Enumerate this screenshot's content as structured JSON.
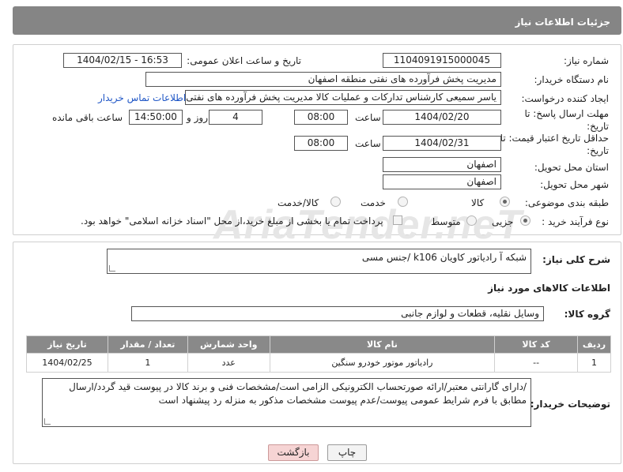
{
  "header": {
    "title": "جزئیات اطلاعات نیاز"
  },
  "fields": {
    "need_number_label": "شماره نیاز:",
    "need_number": "1104091915000045",
    "announce_label": "تاریخ و ساعت اعلان عمومی:",
    "announce_value": "1404/02/15 - 16:53",
    "buyer_org_label": "نام دستگاه خریدار:",
    "buyer_org": "مدیریت پخش فرآورده های نفتی منطقه اصفهان",
    "requester_label": "ایجاد کننده درخواست:",
    "requester": "یاسر  سمیعی کارشناس تدارکات و عملیات کالا مدیریت پخش فرآورده های نفتی",
    "contact_link": "اطلاعات تماس خریدار",
    "deadline_label": "مهلت ارسال پاسخ: تا تاریخ:",
    "deadline_date": "1404/02/20",
    "time_label": "ساعت",
    "deadline_time": "08:00",
    "days_value": "4",
    "days_label": "روز و",
    "remaining_time": "14:50:00",
    "remaining_label": "ساعت باقی مانده",
    "validity_label": "حداقل تاریخ اعتبار قیمت: تا تاریخ:",
    "validity_date": "1404/02/31",
    "validity_time": "08:00",
    "province_label": "استان محل تحویل:",
    "province": "اصفهان",
    "city_label": "شهر محل تحویل:",
    "city": "اصفهان",
    "category_label": "طبقه بندی موضوعی:",
    "category_options": [
      "کالا",
      "خدمت",
      "کالا/خدمت"
    ],
    "process_label": "نوع فرآیند خرید :",
    "process_options": [
      "جزیی",
      "متوسط"
    ],
    "payment_note": "پرداخت تمام یا بخشی از مبلغ خرید،از محل \"اسناد خزانه اسلامی\" خواهد بود."
  },
  "description": {
    "label": "شرح کلی نیاز:",
    "value": "شبکه آ رادیاتور کاویان k106 /جنس مسی"
  },
  "goods_section_title": "اطلاعات کالاهای مورد نیاز",
  "goods_group": {
    "label": "گروه کالا:",
    "value": "وسایل نقلیه، قطعات و لوازم جانبی"
  },
  "table": {
    "headers": [
      "ردیف",
      "کد کالا",
      "نام کالا",
      "واحد شمارش",
      "تعداد / مقدار",
      "تاریخ نیاز"
    ],
    "rows": [
      [
        "1",
        "--",
        "رادیاتور موتور خودرو سنگین",
        "عدد",
        "1",
        "1404/02/25"
      ]
    ]
  },
  "buyer_notes": {
    "label": "توضیحات خریدار:",
    "value": "/دارای گارانتی معتبر/ارائه صورتحساب الکترونیکی الزامی است/مشخصات فنی و برند کالا در پیوست قید گردد/ارسال مطابق با فرم شرایط عمومی پیوست/عدم پیوست مشخصات مذکور به منزله رد پیشنهاد است"
  },
  "buttons": {
    "print": "چاپ",
    "back": "بازگشت"
  },
  "watermark": "AriaTender.neT",
  "colors": {
    "header_bg": "#858585",
    "link": "#1f56c6",
    "back_button": "#f6d4d4"
  }
}
